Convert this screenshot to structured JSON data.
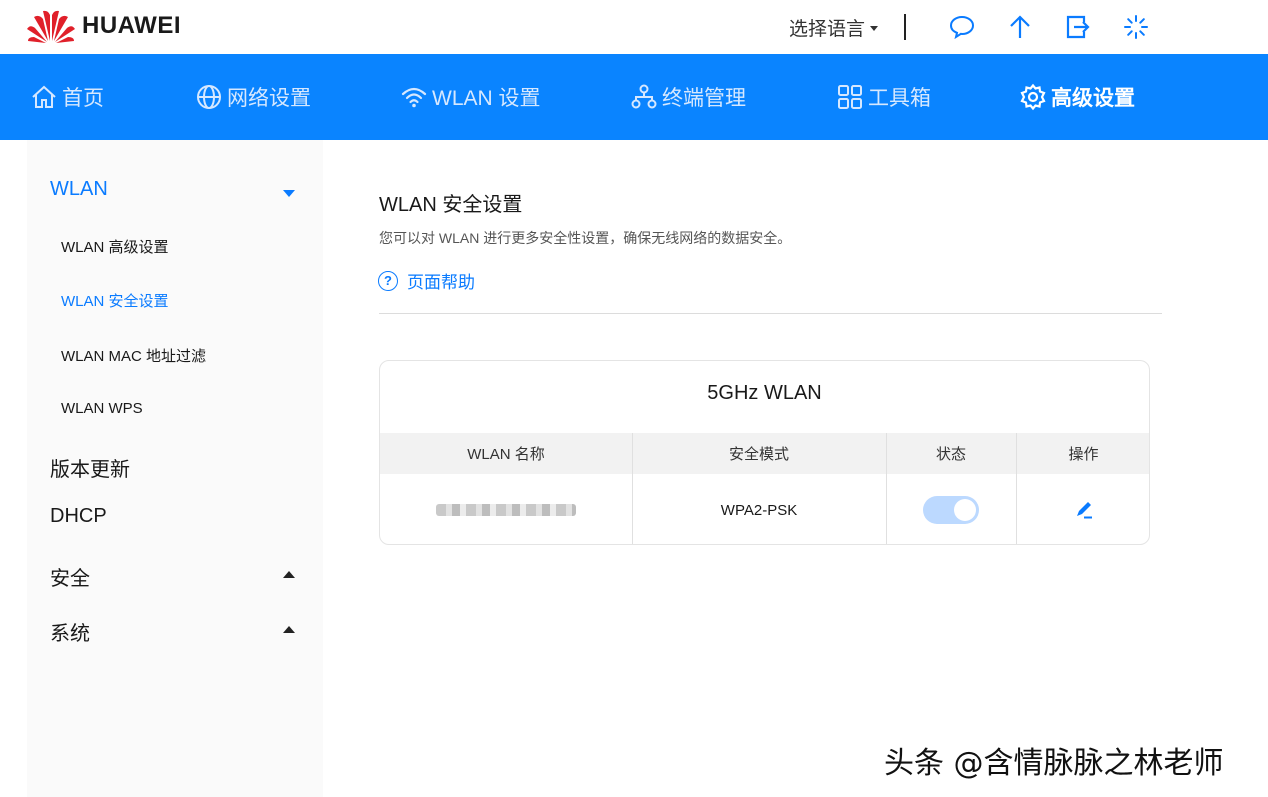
{
  "header": {
    "brand": "HUAWEI",
    "language_label": "选择语言",
    "icons": [
      "message-icon",
      "upload-icon",
      "logout-icon",
      "loading-icon"
    ]
  },
  "nav": {
    "items": [
      {
        "label": "首页",
        "icon": "home-icon"
      },
      {
        "label": "网络设置",
        "icon": "globe-icon"
      },
      {
        "label": "WLAN 设置",
        "icon": "wifi-icon"
      },
      {
        "label": "终端管理",
        "icon": "device-tree-icon"
      },
      {
        "label": "工具箱",
        "icon": "grid-icon"
      },
      {
        "label": "高级设置",
        "icon": "gear-icon"
      }
    ],
    "active_index": 5
  },
  "sidebar": {
    "groups": [
      {
        "label": "WLAN",
        "expanded": true,
        "active": true
      },
      {
        "label": "版本更新"
      },
      {
        "label": "DHCP"
      },
      {
        "label": "安全",
        "expanded": false
      },
      {
        "label": "系统",
        "expanded": false
      }
    ],
    "wlan_subitems": [
      "WLAN 高级设置",
      "WLAN 安全设置",
      "WLAN MAC 地址过滤",
      "WLAN WPS"
    ],
    "active_subitem": "WLAN 安全设置"
  },
  "main": {
    "title": "WLAN 安全设置",
    "description": "您可以对 WLAN 进行更多安全性设置，确保无线网络的数据安全。",
    "help_label": "页面帮助",
    "card": {
      "title": "5GHz WLAN",
      "columns": [
        "WLAN 名称",
        "安全模式",
        "状态",
        "操作"
      ],
      "rows": [
        {
          "name_blurred": true,
          "security_mode": "WPA2-PSK",
          "enabled": true
        }
      ]
    }
  },
  "watermark": "头条 @含情脉脉之林老师",
  "colors": {
    "accent": "#0a84ff",
    "link": "#0a7bff",
    "logo_red": "#e0202a"
  }
}
